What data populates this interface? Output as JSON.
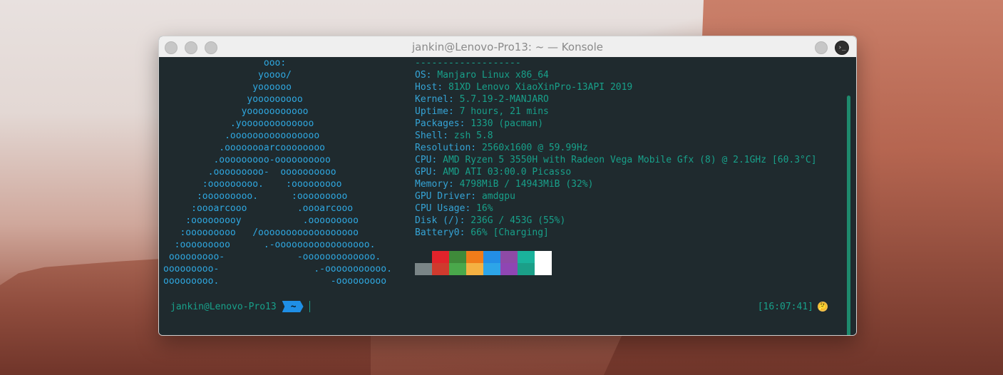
{
  "window": {
    "title": "jankin@Lenovo-Pro13: ~ — Konsole",
    "titlebar_icons": [
      "minimize-icon",
      "maximize-icon",
      "close-icon",
      "terminal-menu-icon"
    ]
  },
  "neofetch": {
    "logo_lines": [
      "                  ooo:",
      "                 yoooo/",
      "                yoooooo",
      "               yooooooooo",
      "              yooooooooooo",
      "            .yooooooooooooo",
      "           .oooooooooooooooo",
      "          .oooooooarcoooooooo",
      "         .ooooooooo-oooooooooo",
      "        .ooooooooo-  oooooooooo",
      "       :ooooooooo.    :ooooooooo",
      "      :ooooooooo.      :ooooooooo",
      "     :oooarcooo         .oooarcooo",
      "    :ooooooooy           .ooooooooo",
      "   :ooooooooo   /oooooooooooooooooo",
      "  :ooooooooo      .-ooooooooooooooooo.",
      " ooooooooo-             -ooooooooooooo.",
      "ooooooooo-                 .-ooooooooooo.",
      "ooooooooo.                    -ooooooooo"
    ],
    "header_separator": "-------------------",
    "info": [
      {
        "key": "OS",
        "value": "Manjaro Linux x86_64"
      },
      {
        "key": "Host",
        "value": "81XD Lenovo XiaoXinPro-13API 2019"
      },
      {
        "key": "Kernel",
        "value": "5.7.19-2-MANJARO"
      },
      {
        "key": "Uptime",
        "value": "7 hours, 21 mins"
      },
      {
        "key": "Packages",
        "value": "1330 (pacman)"
      },
      {
        "key": "Shell",
        "value": "zsh 5.8"
      },
      {
        "key": "Resolution",
        "value": "2560x1600 @ 59.99Hz"
      },
      {
        "key": "CPU",
        "value": "AMD Ryzen 5 3550H with Radeon Vega Mobile Gfx (8) @ 2.1GHz [60.3°C]"
      },
      {
        "key": "GPU",
        "value": "AMD ATI 03:00.0 Picasso"
      },
      {
        "key": "Memory",
        "value": "4798MiB / 14943MiB (32%)"
      },
      {
        "key": "GPU Driver",
        "value": "amdgpu"
      },
      {
        "key": "CPU Usage",
        "value": "16%"
      },
      {
        "key": "Disk (/)",
        "value": "236G / 453G (55%)"
      },
      {
        "key": "Battery0",
        "value": "66% [Charging]"
      }
    ],
    "palette": {
      "top": [
        "#1f2a2e",
        "#e1232b",
        "#3f8a3a",
        "#f07c1a",
        "#238ee6",
        "#8e4aa6",
        "#1ab39c",
        "#ffffff"
      ],
      "bottom": [
        "#7a8587",
        "#cf3a2e",
        "#4aa84b",
        "#f4b142",
        "#2da5e8",
        "#8f46b3",
        "#1b9f88",
        "#ffffff"
      ]
    }
  },
  "prompt": {
    "user_host": "jankin@Lenovo-Pro13",
    "cwd": "~",
    "time": "[16:07:41]",
    "emoji": "🤔"
  }
}
